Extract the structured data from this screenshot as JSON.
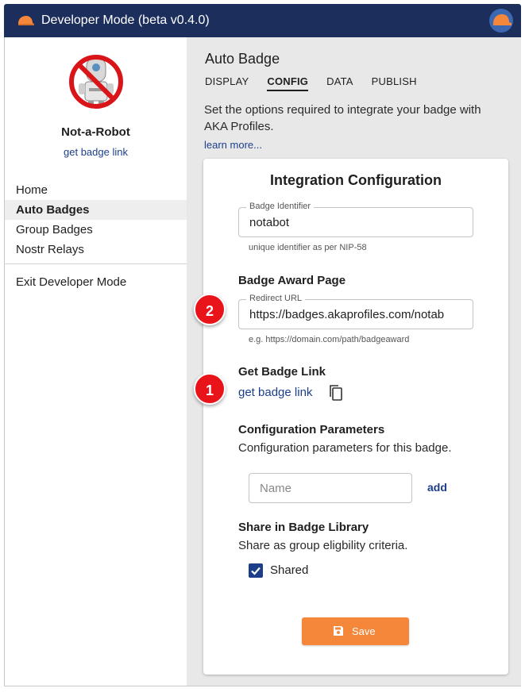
{
  "window": {
    "title": "Developer Mode (beta v0.4.0)"
  },
  "profile": {
    "name": "Not-a-Robot",
    "link_label": "get badge link"
  },
  "sidebar": {
    "items": [
      {
        "label": "Home",
        "active": false
      },
      {
        "label": "Auto Badges",
        "active": true
      },
      {
        "label": "Group Badges",
        "active": false
      },
      {
        "label": "Nostr Relays",
        "active": false
      }
    ],
    "exit_label": "Exit Developer Mode"
  },
  "main": {
    "title": "Auto Badge",
    "tabs": [
      {
        "label": "DISPLAY",
        "active": false
      },
      {
        "label": "CONFIG",
        "active": true
      },
      {
        "label": "DATA",
        "active": false
      },
      {
        "label": "PUBLISH",
        "active": false
      }
    ],
    "intro": "Set the options required to integrate your badge with AKA Profiles.",
    "learn_more": "learn more..."
  },
  "card": {
    "title": "Integration Configuration",
    "identifier": {
      "label": "Badge Identifier",
      "value": "notabot",
      "helper": "unique identifier as per NIP-58"
    },
    "award_page": {
      "heading": "Badge Award Page",
      "label": "Redirect URL",
      "value": "https://badges.akaprofiles.com/notab",
      "helper": "e.g. https://domain.com/path/badgeaward"
    },
    "badge_link": {
      "heading": "Get Badge Link",
      "link_label": "get badge link"
    },
    "config_params": {
      "heading": "Configuration Parameters",
      "description": "Configuration parameters for this badge.",
      "name_placeholder": "Name",
      "add_label": "add"
    },
    "share": {
      "heading": "Share in Badge Library",
      "description": "Share as group eligbility criteria.",
      "checkbox_label": "Shared",
      "checked": true
    },
    "save_label": "Save"
  },
  "annotations": {
    "marker_1": "1",
    "marker_2": "2"
  },
  "colors": {
    "titlebar": "#1c2e5c",
    "accent": "#f5873a",
    "link": "#1c3e8a",
    "marker": "#e8141a"
  },
  "icons": [
    "cap-icon",
    "no-robot-avatar-icon",
    "copy-icon",
    "checkbox-checked-icon",
    "save-icon"
  ]
}
